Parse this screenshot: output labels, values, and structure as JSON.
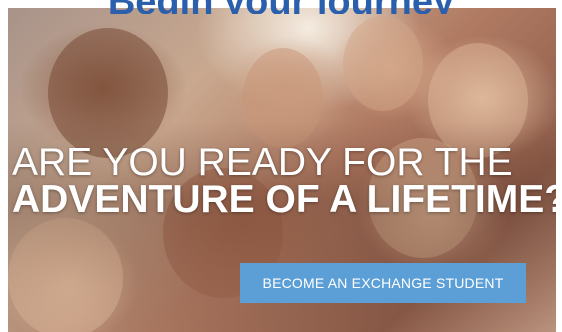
{
  "header": {
    "partial_heading": "Begin your journey"
  },
  "hero": {
    "headline_line1": "ARE YOU READY FOR THE",
    "headline_line2": "ADVENTURE OF A LIFETIME?",
    "cta_label": "BECOME AN EXCHANGE STUDENT"
  },
  "colors": {
    "heading": "#2a5fae",
    "cta_background": "#5b9fd6",
    "headline_text": "#ffffff"
  }
}
